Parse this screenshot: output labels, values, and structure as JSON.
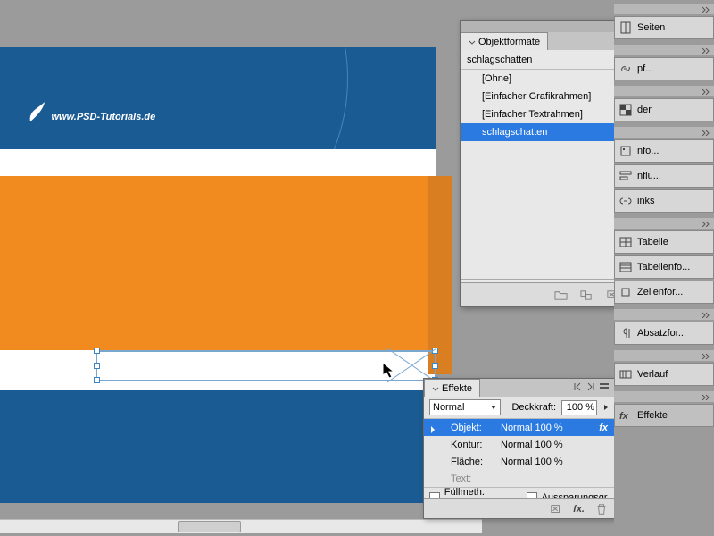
{
  "canvas": {
    "site_text": "www.PSD-Tutorials.de"
  },
  "objektformate": {
    "title": "Objektformate",
    "search_value": "schlagschatten",
    "items": [
      {
        "label": "[Ohne]",
        "icon": "none"
      },
      {
        "label": "[Einfacher Grafikrahmen]",
        "icon": "gframe"
      },
      {
        "label": "[Einfacher Textrahmen]",
        "icon": "tframe"
      },
      {
        "label": "schlagschatten",
        "icon": "",
        "selected": true
      }
    ]
  },
  "effekte": {
    "title": "Effekte",
    "blend_mode": "Normal",
    "opacity_label": "Deckkraft:",
    "opacity_value": "100 %",
    "rows": [
      {
        "label": "Objekt:",
        "value": "Normal 100 %",
        "selected": true,
        "fx": true
      },
      {
        "label": "Kontur:",
        "value": "Normal 100 %"
      },
      {
        "label": "Fläche:",
        "value": "Normal 100 %"
      },
      {
        "label": "Text:",
        "value": "",
        "dim": true
      }
    ],
    "check1": "Füllmeth. isolieren",
    "check2": "Aussparungsgr."
  },
  "rightbar": {
    "groups": [
      {
        "items": [
          {
            "label": "Seiten",
            "icon": "pages"
          }
        ]
      },
      {
        "items": [
          {
            "label": "pf...",
            "icon": "link"
          }
        ]
      },
      {
        "items": [
          {
            "label": "der",
            "icon": "swatch"
          }
        ]
      },
      {
        "items": [
          {
            "label": "nfo...",
            "icon": "info"
          },
          {
            "label": "nflu...",
            "icon": "align"
          },
          {
            "label": "inks",
            "icon": "chain"
          }
        ]
      },
      {
        "items": [
          {
            "label": "Tabelle",
            "icon": "table"
          },
          {
            "label": "Tabellenfo...",
            "icon": "tablefmt"
          },
          {
            "label": "Zellenfor...",
            "icon": "cellfmt"
          }
        ]
      },
      {
        "items": [
          {
            "label": "Absatzfor...",
            "icon": "para"
          }
        ]
      },
      {
        "items": [
          {
            "label": "Verlauf",
            "icon": "gradient"
          }
        ]
      },
      {
        "items": [
          {
            "label": "Effekte",
            "icon": "fx",
            "active": true
          }
        ]
      }
    ]
  }
}
